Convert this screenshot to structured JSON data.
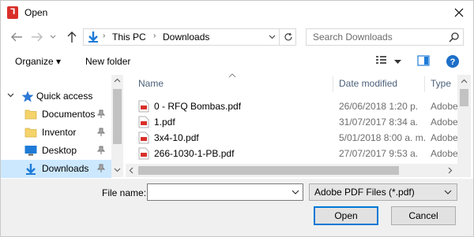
{
  "window": {
    "title": "Open",
    "app_icon_glyph": "⅂"
  },
  "address": {
    "segments": [
      "This PC",
      "Downloads"
    ],
    "search_placeholder": "Search Downloads"
  },
  "toolbar": {
    "organize_label": "Organize ▾",
    "new_folder_label": "New folder"
  },
  "nav": {
    "items": [
      {
        "label": "Quick access",
        "icon": "star-icon",
        "color": "#2b78d6"
      },
      {
        "label": "Documentos",
        "icon": "folder-icon",
        "color": "#f4d36b"
      },
      {
        "label": "Inventor",
        "icon": "folder-icon",
        "color": "#f4d36b"
      },
      {
        "label": "Desktop",
        "icon": "desktop-icon",
        "color": "#1e7bd7"
      },
      {
        "label": "Downloads",
        "icon": "download-icon",
        "color": "#1e7bd7"
      }
    ]
  },
  "files": {
    "columns": [
      "Name",
      "Date modified",
      "Type"
    ],
    "rows": [
      {
        "name": "0 - RFQ Bombas.pdf",
        "date": "26/06/2018 1:20 p.",
        "type": "Adobe"
      },
      {
        "name": "1.pdf",
        "date": "31/07/2017 8:34 a.",
        "type": "Adobe"
      },
      {
        "name": "3x4-10.pdf",
        "date": "5/01/2018 8:00 a. m.",
        "type": "Adobe"
      },
      {
        "name": "266-1030-1-PB.pdf",
        "date": "27/07/2017 9:53 a.",
        "type": "Adobe"
      }
    ]
  },
  "bottom": {
    "file_name_label": "File name:",
    "file_name_value": "",
    "filter_value": "Adobe PDF Files (*.pdf)",
    "open_label": "Open",
    "cancel_label": "Cancel"
  },
  "colors": {
    "accent": "#0078d7",
    "selection": "#cce8ff",
    "pdf_red": "#d9302a"
  }
}
